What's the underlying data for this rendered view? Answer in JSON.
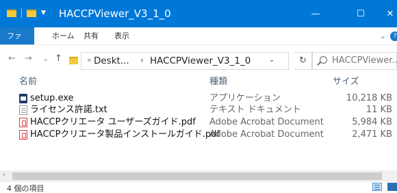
{
  "window": {
    "title": "HACCPViewer_V3_1_0",
    "minimize_glyph": "—",
    "maximize_glyph": "☐",
    "close_glyph": "✕"
  },
  "ribbon": {
    "tabs": [
      {
        "label": "ファイル",
        "active": true
      },
      {
        "label": "ホーム",
        "active": false
      },
      {
        "label": "共有",
        "active": false
      },
      {
        "label": "表示",
        "active": false
      }
    ],
    "help_glyph": "?"
  },
  "nav": {
    "back_glyph": "←",
    "forward_glyph": "→",
    "recent_glyph": "⌄",
    "up_glyph": "↑",
    "breadcrumb_more": "«",
    "breadcrumb": [
      "Deskt...",
      "HACCPViewer_V3_1_0"
    ],
    "breadcrumb_separator": "›",
    "dropdown_glyph": "⌄",
    "refresh_glyph": "↻",
    "search_placeholder": "HACCPViewer..."
  },
  "columns": {
    "name": "名前",
    "type": "種類",
    "size": "サイズ"
  },
  "files": [
    {
      "name": "setup.exe",
      "type": "アプリケーション",
      "size": "10,218 KB",
      "icon": "exe-icon"
    },
    {
      "name": "ライセンス許諾.txt",
      "type": "テキスト ドキュメント",
      "size": "11 KB",
      "icon": "txt-icon"
    },
    {
      "name": "HACCPクリエータ ユーザーズガイド.pdf",
      "type": "Adobe Acrobat Document",
      "size": "5,984 KB",
      "icon": "pdf-icon"
    },
    {
      "name": "HACCPクリエータ製品インストールガイド.pdf",
      "type": "Adobe Acrobat Document",
      "size": "2,471 KB",
      "icon": "pdf-icon"
    }
  ],
  "scrollbar": {
    "left_glyph": "‹"
  },
  "status": {
    "item_count": "4 個の項目"
  },
  "colors": {
    "titlebar": "#0078d7",
    "file_tab": "#1979ca",
    "header_text": "#4c607a"
  }
}
